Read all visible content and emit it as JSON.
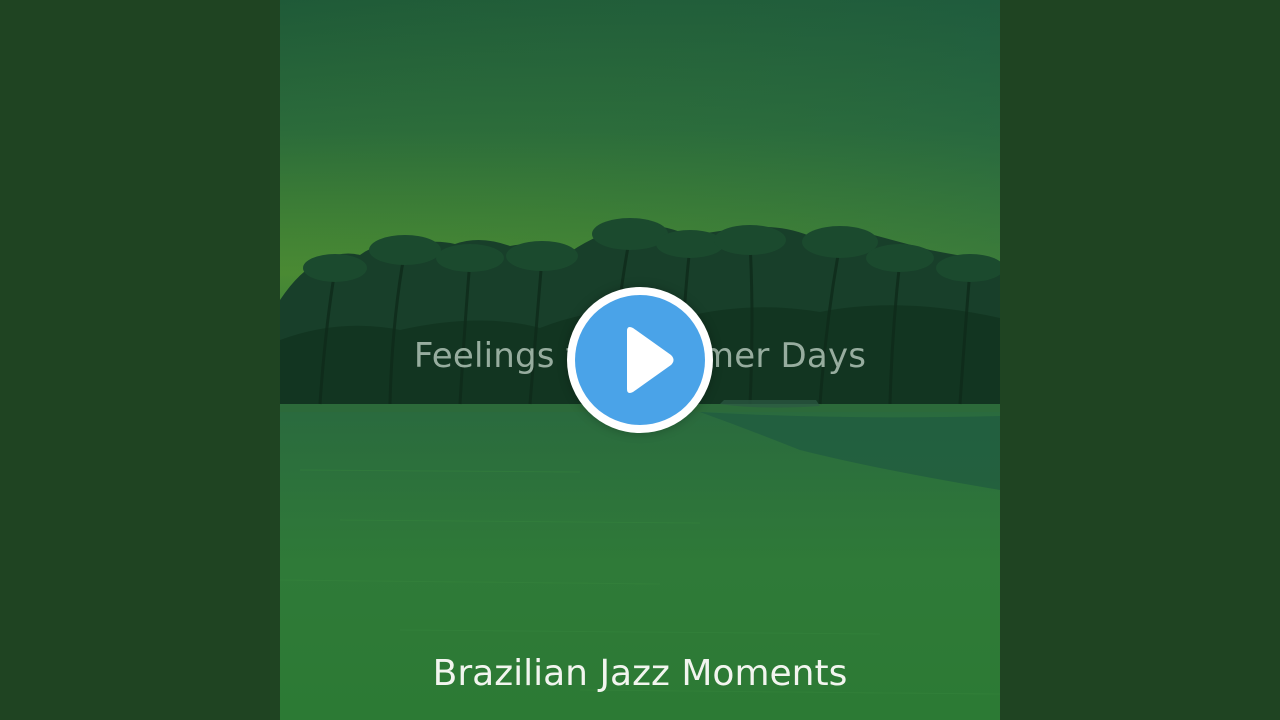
{
  "video": {
    "album_title": "Feelings for Summer Days",
    "artist_name": "Brazilian Jazz Moments"
  },
  "controls": {
    "play_icon": "play-icon",
    "play_accent": "#4aa3e8"
  },
  "colors": {
    "background": "#1f4422",
    "sky": "#3e7f35",
    "sea": "#2f7a38"
  }
}
